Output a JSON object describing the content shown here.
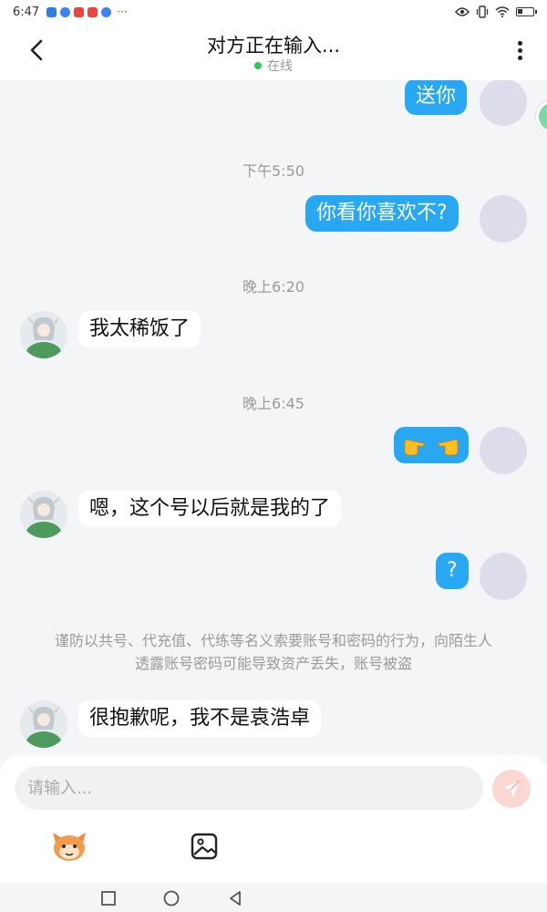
{
  "status_bar": {
    "time": "6:47",
    "more": "···",
    "app_icon_colors": [
      "#2f7de1",
      "#3b82f6",
      "#e8453c",
      "#e8453c",
      "#3b82f6"
    ],
    "right_icons": [
      "eye-icon",
      "vibrate-icon",
      "wifi-icon",
      "battery-icon"
    ]
  },
  "header": {
    "back_icon": "chevron-left-icon",
    "title": "对方正在输入...",
    "status": "在线",
    "status_color": "#2ec85a",
    "menu_icon": "more-vertical-icon"
  },
  "messages": [
    {
      "type": "outgoing",
      "text": "送你"
    },
    {
      "type": "time",
      "text": "下午5:50"
    },
    {
      "type": "outgoing",
      "text": "你看你喜欢不?"
    },
    {
      "type": "time",
      "text": "晚上6:20"
    },
    {
      "type": "incoming",
      "text": "我太稀饭了"
    },
    {
      "type": "time",
      "text": "晚上6:45"
    },
    {
      "type": "outgoing",
      "text": "👉👈",
      "content": "pointing-fingers-emoji"
    },
    {
      "type": "incoming",
      "text": "嗯，这个号以后就是我的了"
    },
    {
      "type": "outgoing",
      "text": "?"
    },
    {
      "type": "notice",
      "text": "谨防以共号、代充值、代练等名义索要账号和密码的行为，向陌生人透露账号密码可能导致资产丢失，账号被盗"
    },
    {
      "type": "incoming",
      "text": "很抱歉呢，我不是袁浩卓"
    }
  ],
  "composer": {
    "placeholder": "请输入...",
    "send_icon": "send-icon",
    "tools": [
      "emoji-mascot-icon",
      "image-icon"
    ]
  },
  "nav_bar": {
    "buttons": [
      "recent-apps-icon",
      "home-icon",
      "back-triangle-icon"
    ]
  },
  "colors": {
    "accent_blue": "#28a8f2",
    "background": "#f4f5f7",
    "send_button": "#fbd7d3",
    "online": "#2ec85a"
  }
}
